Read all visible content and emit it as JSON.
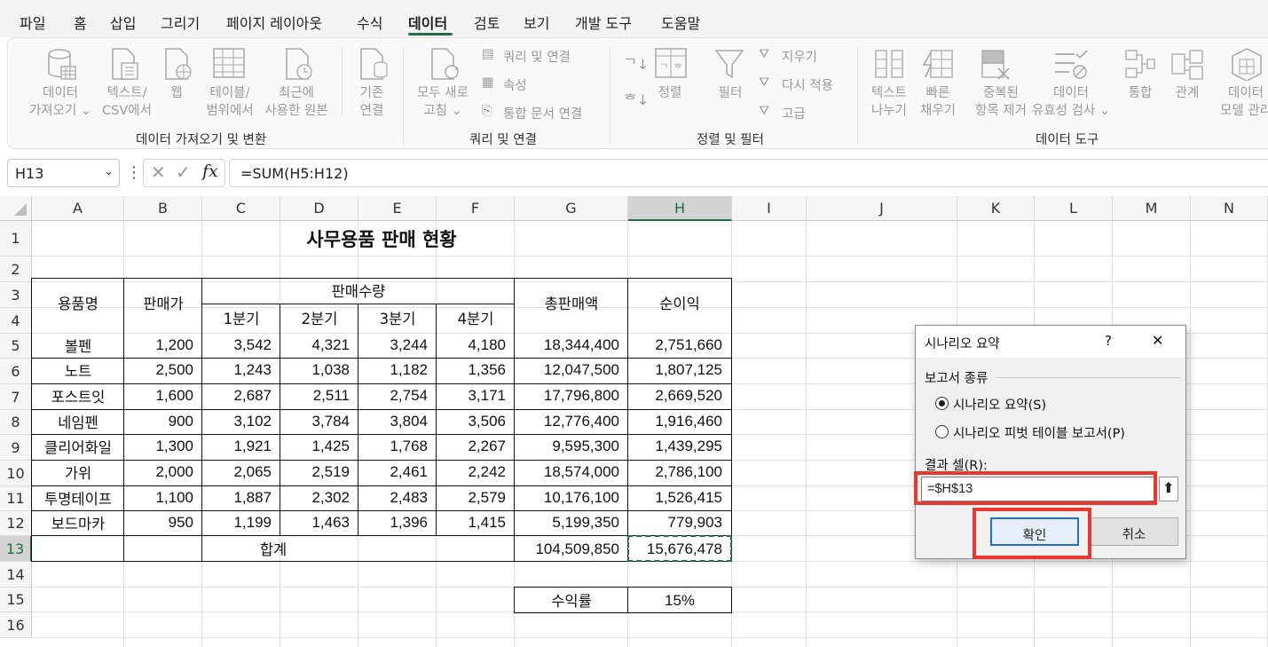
{
  "menu": {
    "tabs": [
      "파일",
      "홈",
      "삽입",
      "그리기",
      "페이지 레이아웃",
      "수식",
      "데이터",
      "검토",
      "보기",
      "개발 도구",
      "도움말"
    ],
    "active": "데이터"
  },
  "ribbon": {
    "get_data": {
      "line1": "데이터",
      "line2": "가져오기 ⌄"
    },
    "text_csv": {
      "line1": "텍스트/",
      "line2": "CSV에서"
    },
    "web": {
      "line1": "웹"
    },
    "table_range": {
      "line1": "테이블/",
      "line2": "범위에서"
    },
    "recent_sources": {
      "line1": "최근에",
      "line2": "사용한 원본"
    },
    "existing_conn": {
      "line1": "기존",
      "line2": "연결"
    },
    "refresh_all": {
      "line1": "모두 새로",
      "line2": "고침 ⌄"
    },
    "queries_conn": "쿼리 및 연결",
    "properties": "속성",
    "edit_links": "통합 문서 연결",
    "sort_az": "↓",
    "sort": "정렬",
    "filter": "필터",
    "clear": "지우기",
    "reapply": "다시 적용",
    "advanced": "고급",
    "text_to_cols": {
      "line1": "텍스트",
      "line2": "나누기"
    },
    "flash_fill": {
      "line1": "빠른",
      "line2": "채우기"
    },
    "remove_dup": {
      "line1": "중복된",
      "line2": "항목 제거"
    },
    "validation": {
      "line1": "데이터",
      "line2": "유효성 검사 ⌄"
    },
    "consolidate": "통합",
    "relationships": "관계",
    "data_model": {
      "line1": "데이터",
      "line2": "모델 관리"
    },
    "groups": {
      "get_transform": "데이터 가져오기 및 변환",
      "queries": "쿼리 및 연결",
      "sort_filter": "정렬 및 필터",
      "data_tools": "데이터 도구"
    }
  },
  "formula_bar": {
    "name_box": "H13",
    "formula": "=SUM(H5:H12)"
  },
  "columns": [
    "A",
    "B",
    "C",
    "D",
    "E",
    "F",
    "G",
    "H",
    "I",
    "J",
    "K",
    "L",
    "M",
    "N"
  ],
  "rows": [
    "1",
    "2",
    "3",
    "4",
    "5",
    "6",
    "7",
    "8",
    "9",
    "10",
    "11",
    "12",
    "13",
    "14",
    "15",
    "16"
  ],
  "sheet": {
    "title": "사무용품 판매 현황",
    "headers": {
      "item": "용품명",
      "price": "판매가",
      "qty": "판매수량",
      "q1": "1분기",
      "q2": "2분기",
      "q3": "3분기",
      "q4": "4분기",
      "total_sales": "총판매액",
      "profit": "순이익"
    },
    "data": [
      [
        "볼펜",
        "1,200",
        "3,542",
        "4,321",
        "3,244",
        "4,180",
        "18,344,400",
        "2,751,660"
      ],
      [
        "노트",
        "2,500",
        "1,243",
        "1,038",
        "1,182",
        "1,356",
        "12,047,500",
        "1,807,125"
      ],
      [
        "포스트잇",
        "1,600",
        "2,687",
        "2,511",
        "2,754",
        "3,171",
        "17,796,800",
        "2,669,520"
      ],
      [
        "네임펜",
        "900",
        "3,102",
        "3,784",
        "3,804",
        "3,506",
        "12,776,400",
        "1,916,460"
      ],
      [
        "클리어화일",
        "1,300",
        "1,921",
        "1,425",
        "1,768",
        "2,267",
        "9,595,300",
        "1,439,295"
      ],
      [
        "가위",
        "2,000",
        "2,065",
        "2,519",
        "2,461",
        "2,242",
        "18,574,000",
        "2,786,100"
      ],
      [
        "투명테이프",
        "1,100",
        "1,887",
        "2,302",
        "2,483",
        "2,579",
        "10,176,100",
        "1,526,415"
      ],
      [
        "보드마카",
        "950",
        "1,199",
        "1,463",
        "1,396",
        "1,415",
        "5,199,350",
        "779,903"
      ]
    ],
    "total_label": "합계",
    "total_sales": "104,509,850",
    "total_profit": "15,676,478",
    "margin_label": "수익률",
    "margin_value": "15%"
  },
  "dialog": {
    "title": "시나리오 요약",
    "help": "?",
    "close": "✕",
    "report_type_label": "보고서 종류",
    "option_summary": "시나리오 요약(S)",
    "option_pivot": "시나리오 피벗 테이블 보고서(P)",
    "result_cells_label": "결과 셀(R):",
    "result_cells_value": "=$H$13",
    "ok": "확인",
    "cancel": "취소"
  }
}
